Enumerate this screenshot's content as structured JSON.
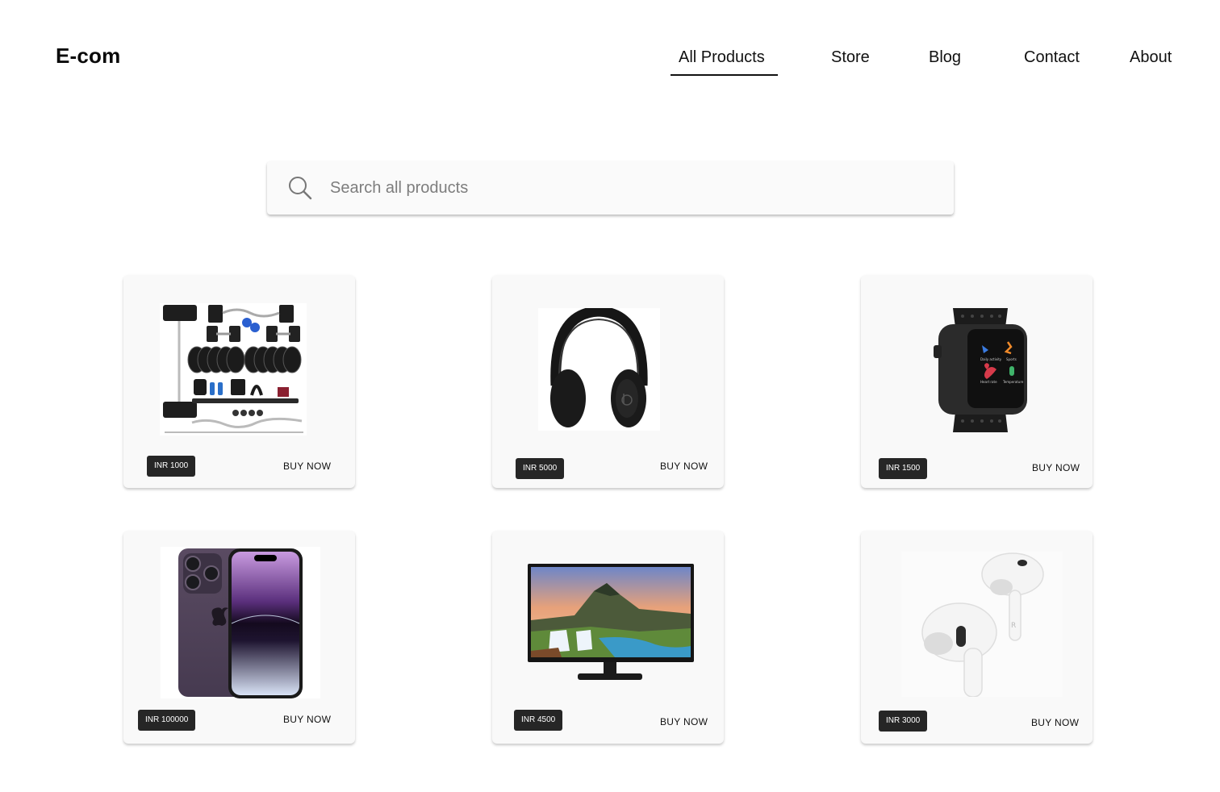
{
  "header": {
    "logo": "E-com",
    "nav": [
      {
        "label": "All Products",
        "active": true
      },
      {
        "label": "Store"
      },
      {
        "label": "Blog"
      },
      {
        "label": "Contact"
      },
      {
        "label": "About"
      }
    ]
  },
  "search": {
    "placeholder": "Search all products",
    "icon": "search-icon"
  },
  "products": [
    {
      "price": "INR 1000",
      "buy_label": "BUY NOW",
      "image": "dumbbell-set-image"
    },
    {
      "price": "INR  5000",
      "buy_label": "BUY NOW",
      "image": "headphones-image"
    },
    {
      "price": "INR 1500",
      "buy_label": "BUY NOW",
      "image": "smartwatch-image"
    },
    {
      "price": "INR 100000",
      "buy_label": "BUY NOW",
      "image": "smartphone-image"
    },
    {
      "price": "INR 4500",
      "buy_label": "BUY NOW",
      "image": "monitor-image"
    },
    {
      "price": "INR 3000",
      "buy_label": "BUY NOW",
      "image": "earbuds-image"
    }
  ],
  "colors": {
    "accent": "#111111",
    "price_badge": "#262626",
    "card_bg": "#f9f9f9"
  }
}
